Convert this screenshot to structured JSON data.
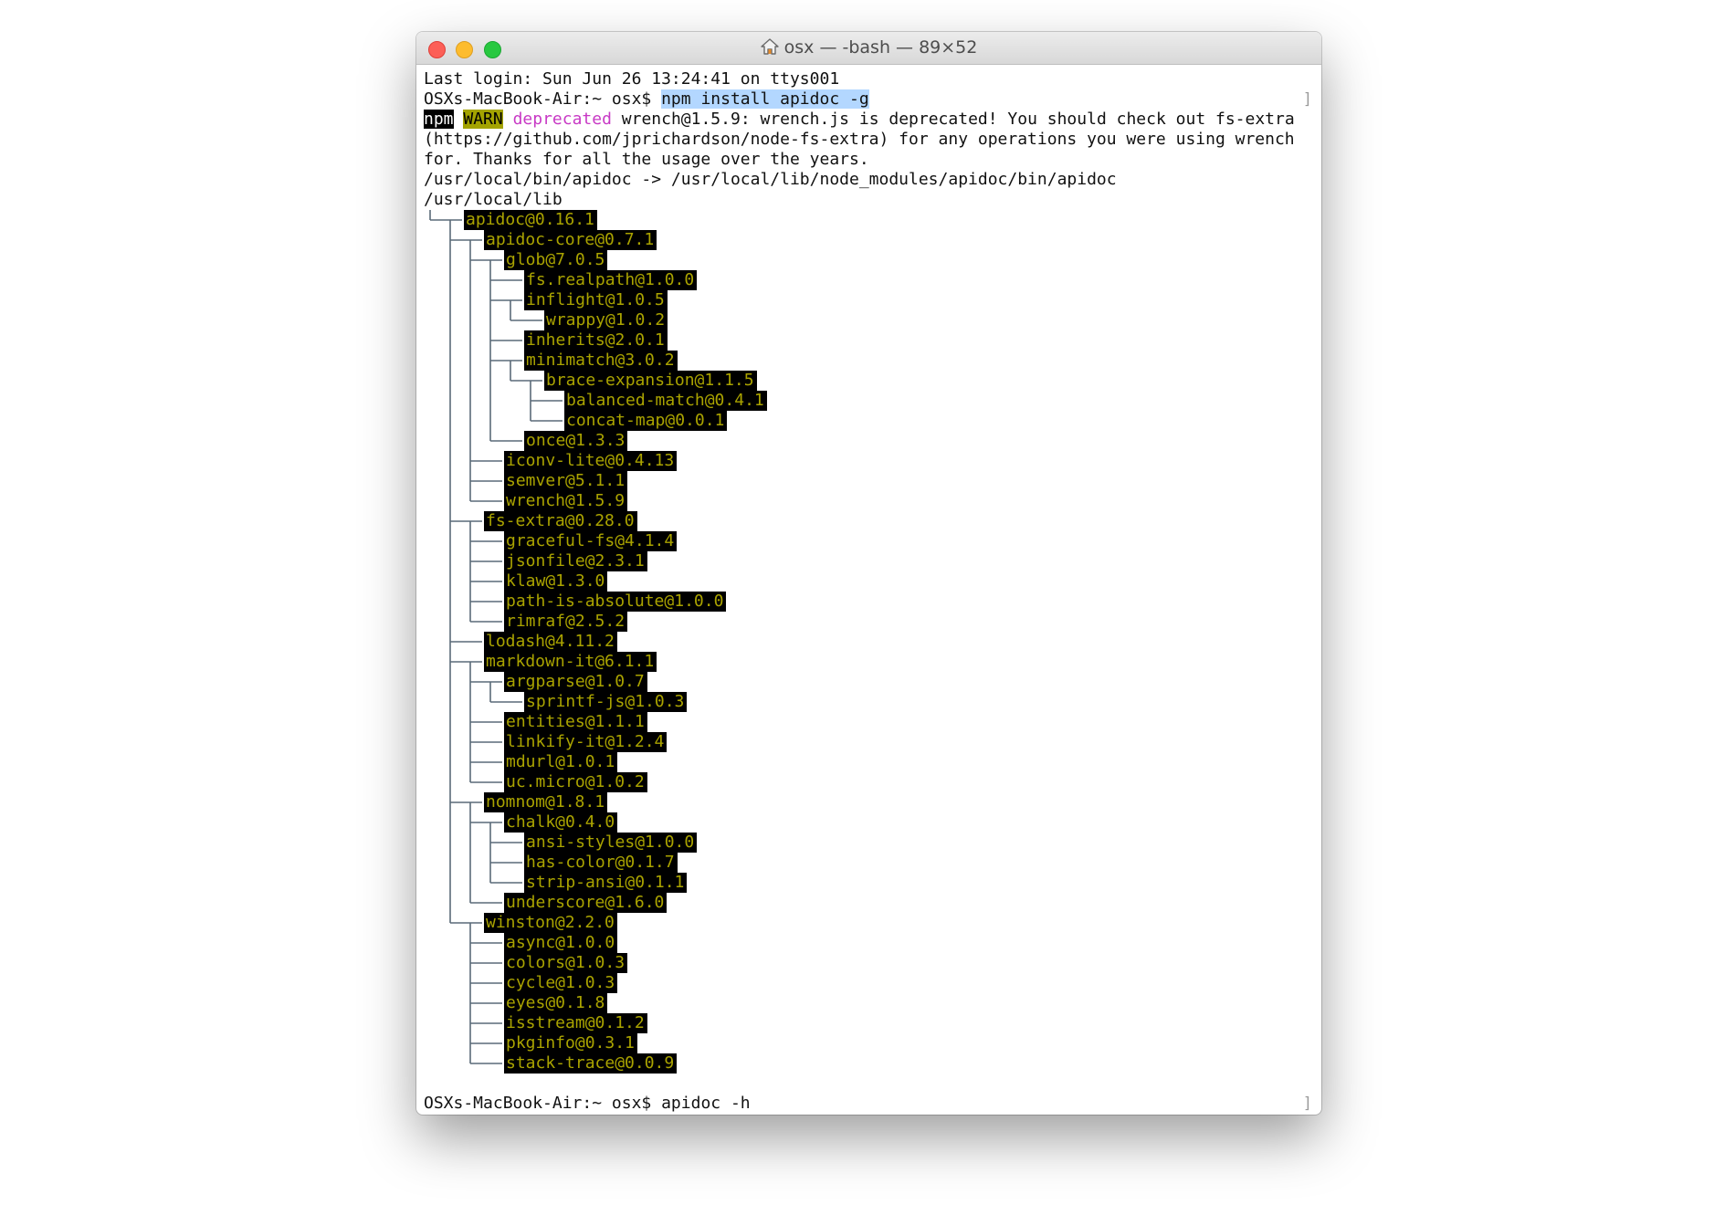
{
  "window": {
    "title": "osx — -bash — 89×52"
  },
  "terminal": {
    "last_login": "Last login: Sun Jun 26 13:24:41 on ttys001",
    "prompt": "OSXs-MacBook-Air:~ osx$ ",
    "command1": "npm install apidoc -g",
    "warn_npm": "npm",
    "warn_label": "WARN",
    "warn_deprecated": "deprecated",
    "warn_msg1": " wrench@1.5.9: wrench.js is deprecated! You should check out fs-extra",
    "warn_msg2": "(https://github.com/jprichardson/node-fs-extra) for any operations you were using wrench",
    "warn_msg3": "for. Thanks for all the usage over the years.",
    "bin_link": "/usr/local/bin/apidoc -> /usr/local/lib/node_modules/apidoc/bin/apidoc",
    "lib_path": "/usr/local/lib",
    "command2": "apidoc -h"
  },
  "tree": [
    {
      "name": "apidoc@0.16.1",
      "depth": 0
    },
    {
      "name": "apidoc-core@0.7.1",
      "depth": 1
    },
    {
      "name": "glob@7.0.5",
      "depth": 2
    },
    {
      "name": "fs.realpath@1.0.0",
      "depth": 3
    },
    {
      "name": "inflight@1.0.5",
      "depth": 3
    },
    {
      "name": "wrappy@1.0.2",
      "depth": 4
    },
    {
      "name": "inherits@2.0.1",
      "depth": 3
    },
    {
      "name": "minimatch@3.0.2",
      "depth": 3
    },
    {
      "name": "brace-expansion@1.1.5",
      "depth": 4
    },
    {
      "name": "balanced-match@0.4.1",
      "depth": 5
    },
    {
      "name": "concat-map@0.0.1",
      "depth": 5
    },
    {
      "name": "once@1.3.3",
      "depth": 3
    },
    {
      "name": "iconv-lite@0.4.13",
      "depth": 2
    },
    {
      "name": "semver@5.1.1",
      "depth": 2
    },
    {
      "name": "wrench@1.5.9",
      "depth": 2
    },
    {
      "name": "fs-extra@0.28.0",
      "depth": 1
    },
    {
      "name": "graceful-fs@4.1.4",
      "depth": 2
    },
    {
      "name": "jsonfile@2.3.1",
      "depth": 2
    },
    {
      "name": "klaw@1.3.0",
      "depth": 2
    },
    {
      "name": "path-is-absolute@1.0.0",
      "depth": 2
    },
    {
      "name": "rimraf@2.5.2",
      "depth": 2
    },
    {
      "name": "lodash@4.11.2",
      "depth": 1
    },
    {
      "name": "markdown-it@6.1.1",
      "depth": 1
    },
    {
      "name": "argparse@1.0.7",
      "depth": 2
    },
    {
      "name": "sprintf-js@1.0.3",
      "depth": 3
    },
    {
      "name": "entities@1.1.1",
      "depth": 2
    },
    {
      "name": "linkify-it@1.2.4",
      "depth": 2
    },
    {
      "name": "mdurl@1.0.1",
      "depth": 2
    },
    {
      "name": "uc.micro@1.0.2",
      "depth": 2
    },
    {
      "name": "nomnom@1.8.1",
      "depth": 1
    },
    {
      "name": "chalk@0.4.0",
      "depth": 2
    },
    {
      "name": "ansi-styles@1.0.0",
      "depth": 3
    },
    {
      "name": "has-color@0.1.7",
      "depth": 3
    },
    {
      "name": "strip-ansi@0.1.1",
      "depth": 3
    },
    {
      "name": "underscore@1.6.0",
      "depth": 2
    },
    {
      "name": "winston@2.2.0",
      "depth": 1
    },
    {
      "name": "async@1.0.0",
      "depth": 2
    },
    {
      "name": "colors@1.0.3",
      "depth": 2
    },
    {
      "name": "cycle@1.0.3",
      "depth": 2
    },
    {
      "name": "eyes@0.1.8",
      "depth": 2
    },
    {
      "name": "isstream@0.1.2",
      "depth": 2
    },
    {
      "name": "pkginfo@0.3.1",
      "depth": 2
    },
    {
      "name": "stack-trace@0.0.9",
      "depth": 2
    }
  ],
  "colors": {
    "selection": "#b3d7ff",
    "package_text": "#aaa300",
    "package_bg": "#000000",
    "deprecated": "#c839c5",
    "warn_bg": "#a3a300"
  }
}
